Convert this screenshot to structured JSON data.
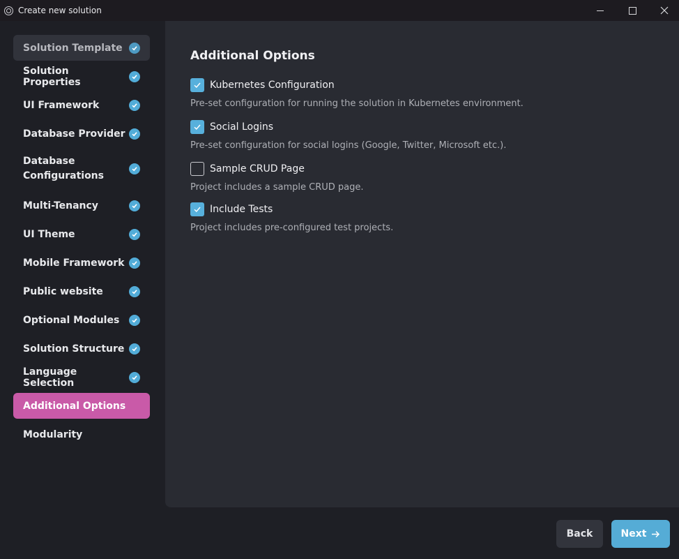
{
  "window": {
    "title": "Create new solution"
  },
  "sidebar": {
    "items": [
      {
        "label": "Solution Template",
        "state": "completed"
      },
      {
        "label": "Solution Properties",
        "state": "completed"
      },
      {
        "label": "UI Framework",
        "state": "completed"
      },
      {
        "label": "Database Provider",
        "state": "completed"
      },
      {
        "label": "Database Configurations",
        "state": "completed"
      },
      {
        "label": "Multi-Tenancy",
        "state": "completed"
      },
      {
        "label": "UI Theme",
        "state": "completed"
      },
      {
        "label": "Mobile Framework",
        "state": "completed"
      },
      {
        "label": "Public website",
        "state": "completed"
      },
      {
        "label": "Optional Modules",
        "state": "completed"
      },
      {
        "label": "Solution Structure",
        "state": "completed"
      },
      {
        "label": "Language Selection",
        "state": "completed"
      },
      {
        "label": "Additional Options",
        "state": "active"
      },
      {
        "label": "Modularity",
        "state": "pending"
      }
    ]
  },
  "main": {
    "title": "Additional Options",
    "options": [
      {
        "label": "Kubernetes Configuration",
        "checked": true,
        "description": "Pre-set configuration for running the solution in Kubernetes environment."
      },
      {
        "label": "Social Logins",
        "checked": true,
        "description": "Pre-set configuration for social logins (Google, Twitter, Microsoft etc.)."
      },
      {
        "label": "Sample CRUD Page",
        "checked": false,
        "description": "Project includes a sample CRUD page."
      },
      {
        "label": "Include Tests",
        "checked": true,
        "description": "Project includes pre-configured test projects."
      }
    ]
  },
  "footer": {
    "back_label": "Back",
    "next_label": "Next"
  },
  "colors": {
    "accent_active": "#c95aa8",
    "accent_check": "#52acd8",
    "next_button": "#55acd6"
  }
}
